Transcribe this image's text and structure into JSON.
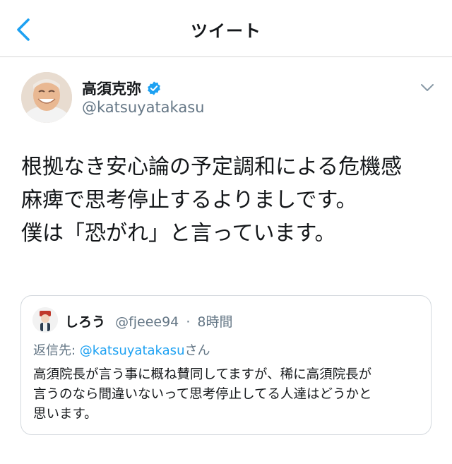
{
  "nav": {
    "title": "ツイート"
  },
  "tweet": {
    "author_name": "高須克弥",
    "author_handle": "@katsuyatakasu",
    "lines": [
      "根拠なき安心論の予定調和による危機感",
      "麻痺で思考停止するよりましです。",
      "僕は「恐がれ」と言っています。"
    ]
  },
  "quote": {
    "name": "しろう",
    "handle": "@fjeee94",
    "separator": "·",
    "time": "8時間",
    "reply_prefix": "返信先: ",
    "reply_handle": "@katsuyatakasu",
    "reply_suffix": "さん",
    "lines": [
      "高須院長が言う事に概ね賛同してますが、稀に高須院長が",
      "言うのなら間違いないって思考停止してる人達はどうかと",
      "思います。"
    ]
  },
  "colors": {
    "accent": "#1da1f2",
    "secondary_text": "#657786",
    "border": "#d6d6d6"
  }
}
